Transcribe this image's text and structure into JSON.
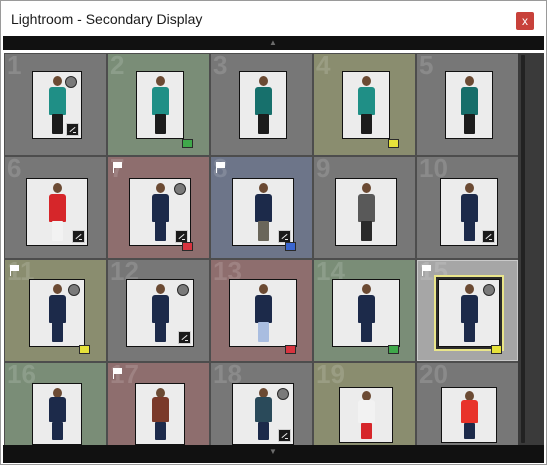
{
  "window": {
    "title": "Lightroom - Secondary Display",
    "close_label": "x",
    "top_grip": "▲",
    "bottom_grip": "▼"
  },
  "cells": [
    {
      "num": "1",
      "bg": "#777777",
      "flag": false,
      "circle": true,
      "develop": true,
      "label": null,
      "outfit": "#1f8f86",
      "legs": "#1c1c1c"
    },
    {
      "num": "2",
      "bg": "#7a8d77",
      "flag": false,
      "circle": false,
      "develop": false,
      "label": "#3fa84a",
      "outfit": "#1f8f86",
      "legs": "#1c1c1c"
    },
    {
      "num": "3",
      "bg": "#777777",
      "flag": false,
      "circle": false,
      "develop": false,
      "label": null,
      "outfit": "#17706c",
      "legs": "#1c1c1c"
    },
    {
      "num": "4",
      "bg": "#8a8d6f",
      "flag": false,
      "circle": false,
      "develop": false,
      "label": "#e6e23a",
      "outfit": "#1f8f86",
      "legs": "#1c1c1c"
    },
    {
      "num": "5",
      "bg": "#777777",
      "flag": false,
      "circle": false,
      "develop": false,
      "label": null,
      "outfit": "#176e6a",
      "legs": "#1c1c1c"
    },
    {
      "num": "6",
      "bg": "#777777",
      "flag": false,
      "circle": false,
      "develop": true,
      "label": null,
      "outfit": "#d6262a",
      "legs": "#f2f2f2"
    },
    {
      "num": "7",
      "bg": "#8e6e6e",
      "flag": true,
      "circle": true,
      "develop": true,
      "label": "#d8343f",
      "outfit": "#1c2a4a",
      "legs": "#1c2a4a"
    },
    {
      "num": "8",
      "bg": "#6d7589",
      "flag": true,
      "circle": false,
      "develop": true,
      "label": "#3a66d0",
      "outfit": "#1c2a4a",
      "legs": "#6a665a"
    },
    {
      "num": "9",
      "bg": "#777777",
      "flag": false,
      "circle": false,
      "develop": false,
      "label": null,
      "outfit": "#595959",
      "legs": "#2a2a2a"
    },
    {
      "num": "10",
      "bg": "#777777",
      "flag": false,
      "circle": false,
      "develop": true,
      "label": null,
      "outfit": "#1c2a4a",
      "legs": "#1c2a4a"
    },
    {
      "num": "11",
      "bg": "#8a8d6f",
      "flag": true,
      "circle": true,
      "develop": false,
      "label": "#e6e23a",
      "outfit": "#1c2a4a",
      "legs": "#1c2a4a"
    },
    {
      "num": "12",
      "bg": "#777777",
      "flag": false,
      "circle": true,
      "develop": true,
      "label": null,
      "outfit": "#1c2a4a",
      "legs": "#1c2a4a"
    },
    {
      "num": "13",
      "bg": "#8e6e6e",
      "flag": false,
      "circle": false,
      "develop": false,
      "label": "#d8343f",
      "outfit": "#1c2a4a",
      "legs": "#a9bde0"
    },
    {
      "num": "14",
      "bg": "#7a8d77",
      "flag": false,
      "circle": false,
      "develop": false,
      "label": "#3fa84a",
      "outfit": "#1c2a4a",
      "legs": "#1c2a4a"
    },
    {
      "num": "15",
      "bg": "#a6a6a6",
      "flag": true,
      "circle": true,
      "develop": false,
      "label": "#e6e23a",
      "outfit": "#1c2a4a",
      "legs": "#1c2a4a",
      "selected": true
    },
    {
      "num": "16",
      "bg": "#7a8d77",
      "flag": false,
      "circle": false,
      "develop": false,
      "label": null,
      "outfit": "#1c2a4a",
      "legs": "#1c2a4a"
    },
    {
      "num": "17",
      "bg": "#8e6e6e",
      "flag": true,
      "circle": false,
      "develop": false,
      "label": null,
      "outfit": "#7a3a2a",
      "legs": "#1c2a4a"
    },
    {
      "num": "18",
      "bg": "#777777",
      "flag": false,
      "circle": true,
      "develop": true,
      "label": null,
      "outfit": "#2a4a5a",
      "legs": "#1c2a4a"
    },
    {
      "num": "19",
      "bg": "#8a8d6f",
      "flag": false,
      "circle": false,
      "develop": false,
      "label": null,
      "outfit": "#f2f2f2",
      "legs": "#d6262a"
    },
    {
      "num": "20",
      "bg": "#777777",
      "flag": false,
      "circle": false,
      "develop": false,
      "label": null,
      "outfit": "#e8332a",
      "legs": "#1c2a4a"
    }
  ]
}
